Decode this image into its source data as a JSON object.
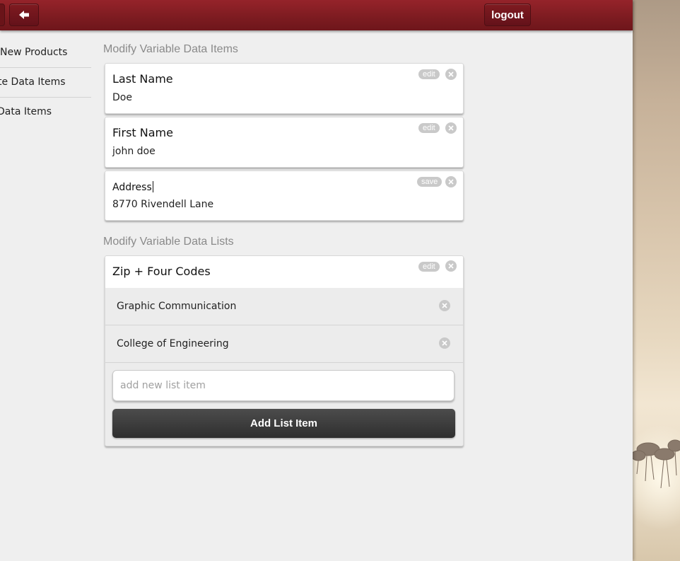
{
  "header": {
    "back_icon": "back-arrow-icon",
    "logout_label": "logout"
  },
  "sidebar": {
    "items": [
      {
        "label": "New Products"
      },
      {
        "label": "te Data Items"
      },
      {
        "label": " Data Items"
      }
    ]
  },
  "data_items": {
    "title": "Modify Variable Data Items",
    "items": [
      {
        "label": "Last Name",
        "value": "Doe",
        "action": "edit"
      },
      {
        "label": "First Name",
        "value": "john doe",
        "action": "edit"
      },
      {
        "label": "Address",
        "value": "8770 Rivendell Lane",
        "action": "save"
      }
    ]
  },
  "data_lists": {
    "title": "Modify Variable Data Lists",
    "list": {
      "label": "Zip + Four Codes",
      "action": "edit",
      "rows": [
        {
          "text": "Graphic Communication"
        },
        {
          "text": "College of Engineering"
        }
      ],
      "new_item_placeholder": "add new list item",
      "new_item_value": "",
      "add_button_label": "Add List Item"
    }
  },
  "colors": {
    "header_bar": "#7c1b20",
    "background": "#efefef",
    "add_button": "#3a3a3a"
  }
}
